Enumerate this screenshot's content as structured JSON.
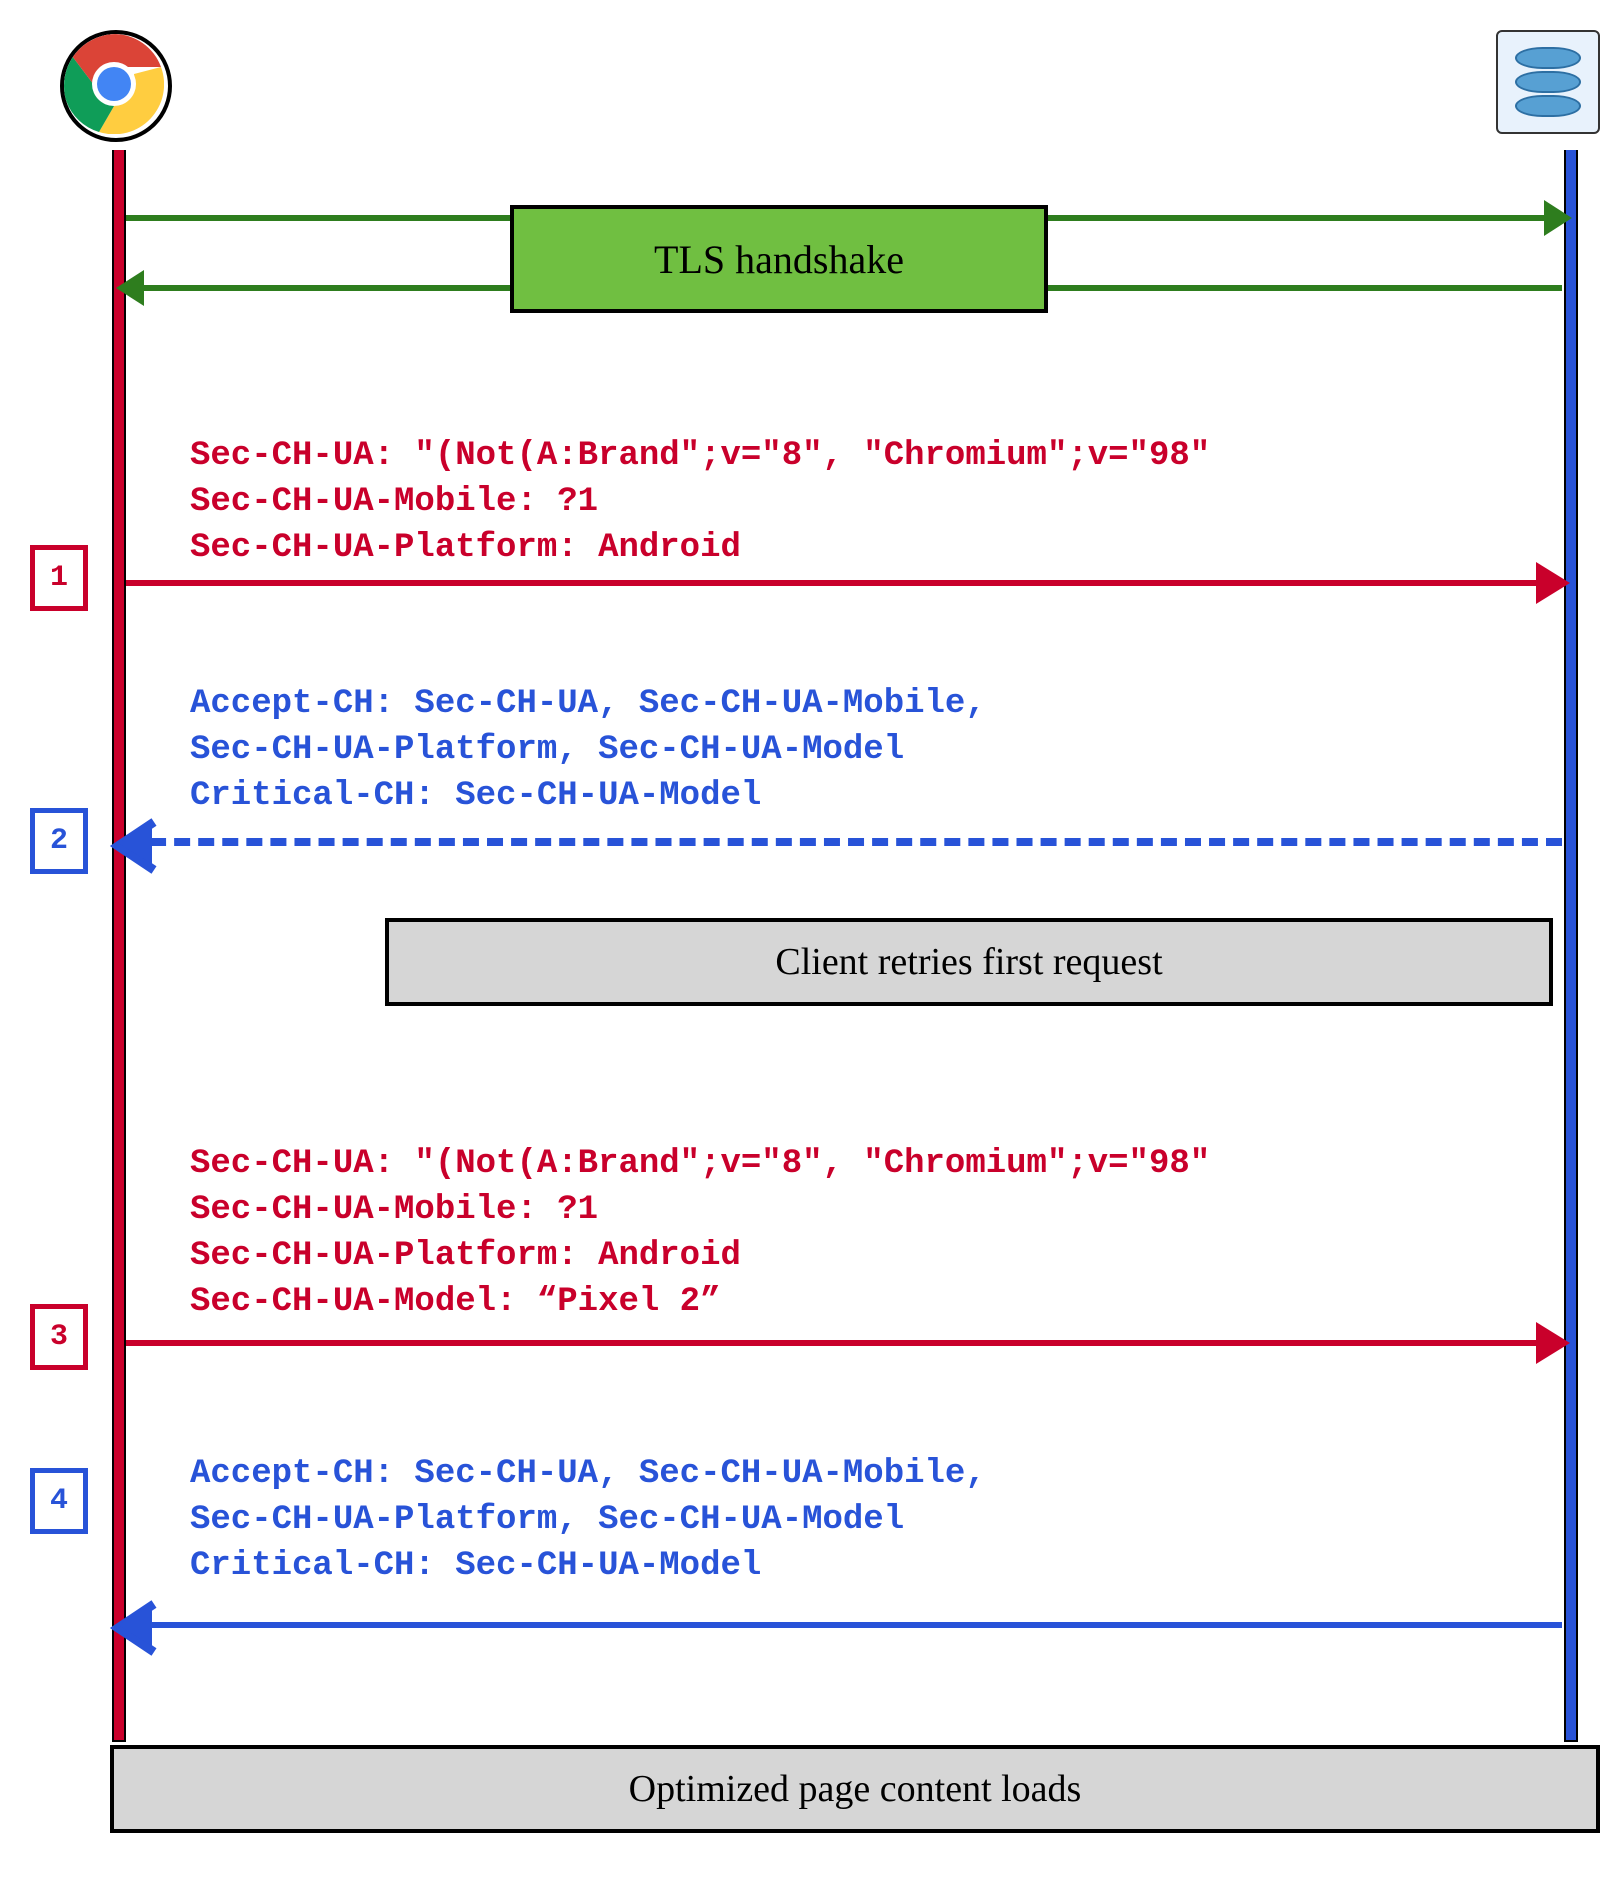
{
  "actors": {
    "client": "Chrome browser",
    "server": "Origin server"
  },
  "tls_label": "TLS handshake",
  "steps": [
    {
      "n": "1",
      "dir": "request",
      "lines": [
        "Sec-CH-UA: \"(Not(A:Brand\";v=\"8\", \"Chromium\";v=\"98\"",
        "Sec-CH-UA-Mobile: ?1",
        "Sec-CH-UA-Platform: Android"
      ]
    },
    {
      "n": "2",
      "dir": "response",
      "lines": [
        "Accept-CH: Sec-CH-UA, Sec-CH-UA-Mobile,",
        "Sec-CH-UA-Platform, Sec-CH-UA-Model",
        "Critical-CH: Sec-CH-UA-Model"
      ],
      "dashed": true
    },
    {
      "n": "3",
      "dir": "request",
      "lines": [
        "Sec-CH-UA: \"(Not(A:Brand\";v=\"8\", \"Chromium\";v=\"98\"",
        "Sec-CH-UA-Mobile: ?1",
        "Sec-CH-UA-Platform: Android",
        "Sec-CH-UA-Model: “Pixel 2”"
      ]
    },
    {
      "n": "4",
      "dir": "response",
      "lines": [
        "Accept-CH: Sec-CH-UA, Sec-CH-UA-Mobile,",
        "Sec-CH-UA-Platform, Sec-CH-UA-Model",
        "Critical-CH: Sec-CH-UA-Model"
      ]
    }
  ],
  "notes": {
    "retry": "Client retries first request",
    "final": "Optimized page content loads"
  },
  "colors": {
    "request": "#c9002b",
    "response": "#2853d8",
    "tls": "#70bf41",
    "tls_arrow": "#2e7d1e"
  }
}
